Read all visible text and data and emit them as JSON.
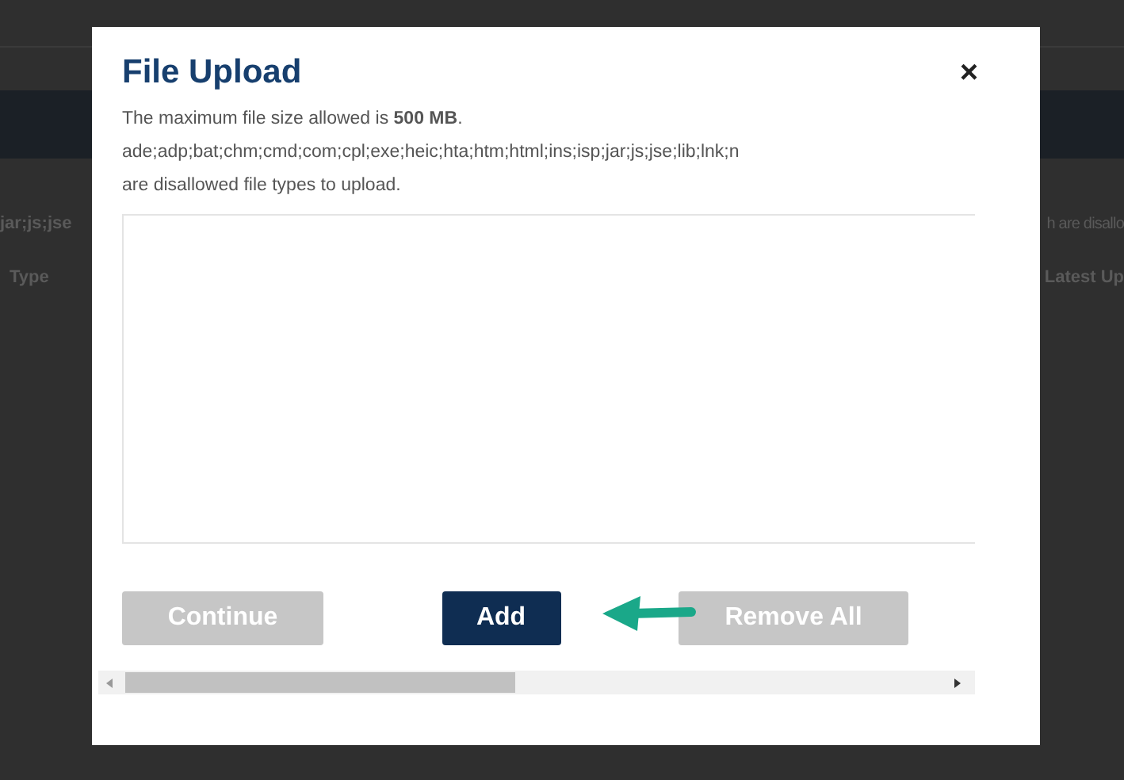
{
  "background_page": {
    "row_1": {
      "left": "jar;js;jse",
      "right": "h are disallo"
    },
    "row_2": {
      "left": "Type",
      "right": "Latest Up"
    }
  },
  "dialog": {
    "title": "File Upload",
    "close": "×",
    "notes": [
      "The maximum file size allowed is **500 MB**.",
      "ade;adp;bat;chm;cmd;com;cpl;exe;heic;hta;htm;html;ins;isp;jar;js;jse;lib;lnk;n",
      "are disallowed file types to upload."
    ],
    "buttons": [
      {
        "label": "Continue",
        "disabled": true
      },
      {
        "label": "Add",
        "disabled": false
      },
      {
        "label": "Remove All",
        "disabled": true
      }
    ]
  }
}
